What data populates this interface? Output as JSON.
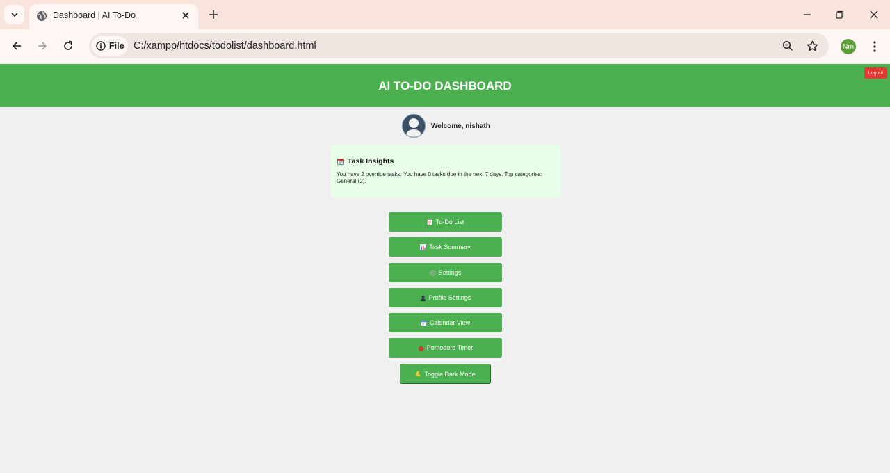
{
  "browser": {
    "tab_title": "Dashboard | AI To-Do",
    "site_info_label": "File",
    "url": "C:/xampp/htdocs/todolist/dashboard.html",
    "profile_initials": "Nm"
  },
  "header": {
    "title": "AI TO-DO DASHBOARD",
    "logout_label": "Logout"
  },
  "welcome": {
    "text": "Welcome, nishath"
  },
  "insights": {
    "icon": "calendar-icon",
    "title": "Task Insights",
    "body": "You have 2 overdue tasks. You have 0 tasks due in the next 7 days. Top categories: General (2)."
  },
  "menu": [
    {
      "label": "To-Do List",
      "icon": "notepad-icon"
    },
    {
      "label": "Task Summary",
      "icon": "bar-chart-icon"
    },
    {
      "label": "Settings",
      "icon": "gear-icon"
    },
    {
      "label": "Profile Settings",
      "icon": "user-icon"
    },
    {
      "label": "Calendar View",
      "icon": "calendar-icon"
    },
    {
      "label": "Pomodoro Timer",
      "icon": "tomato-icon"
    }
  ],
  "dark_mode": {
    "label": "Toggle Dark Mode",
    "icon": "moon-icon"
  },
  "colors": {
    "header_green": "#4caf50",
    "logout_red": "#e53935",
    "insights_bg": "#e6ffe6",
    "page_bg": "#f0f0f0"
  }
}
